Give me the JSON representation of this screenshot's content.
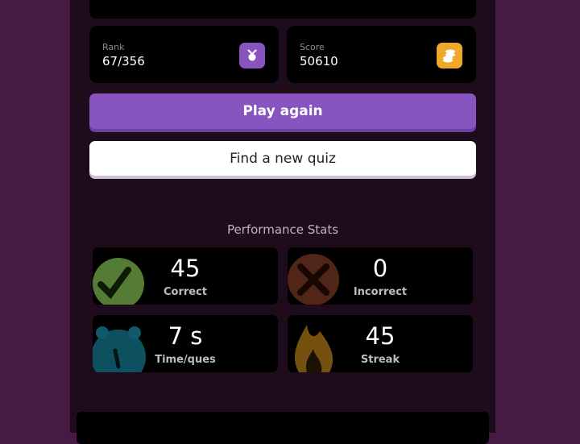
{
  "stats": {
    "rank": {
      "label": "Rank",
      "value": "67/356",
      "icon": "medal-icon",
      "color": "#8854c0"
    },
    "score": {
      "label": "Score",
      "value": "50610",
      "icon": "coins-icon",
      "color": "#efa929"
    }
  },
  "actions": {
    "play_again": "Play again",
    "find_quiz": "Find a new quiz"
  },
  "performance": {
    "title": "Performance Stats",
    "correct": {
      "value": "45",
      "label": "Correct",
      "icon": "check-icon",
      "color": "#5e8a3a"
    },
    "incorrect": {
      "value": "0",
      "label": "Incorrect",
      "icon": "cross-icon",
      "color": "#5a2a1a"
    },
    "time": {
      "value": "7 s",
      "label": "Time/ques",
      "icon": "stopwatch-icon",
      "color": "#0e5a6a"
    },
    "streak": {
      "value": "45",
      "label": "Streak",
      "icon": "flame-icon",
      "color": "#7a5510"
    }
  }
}
